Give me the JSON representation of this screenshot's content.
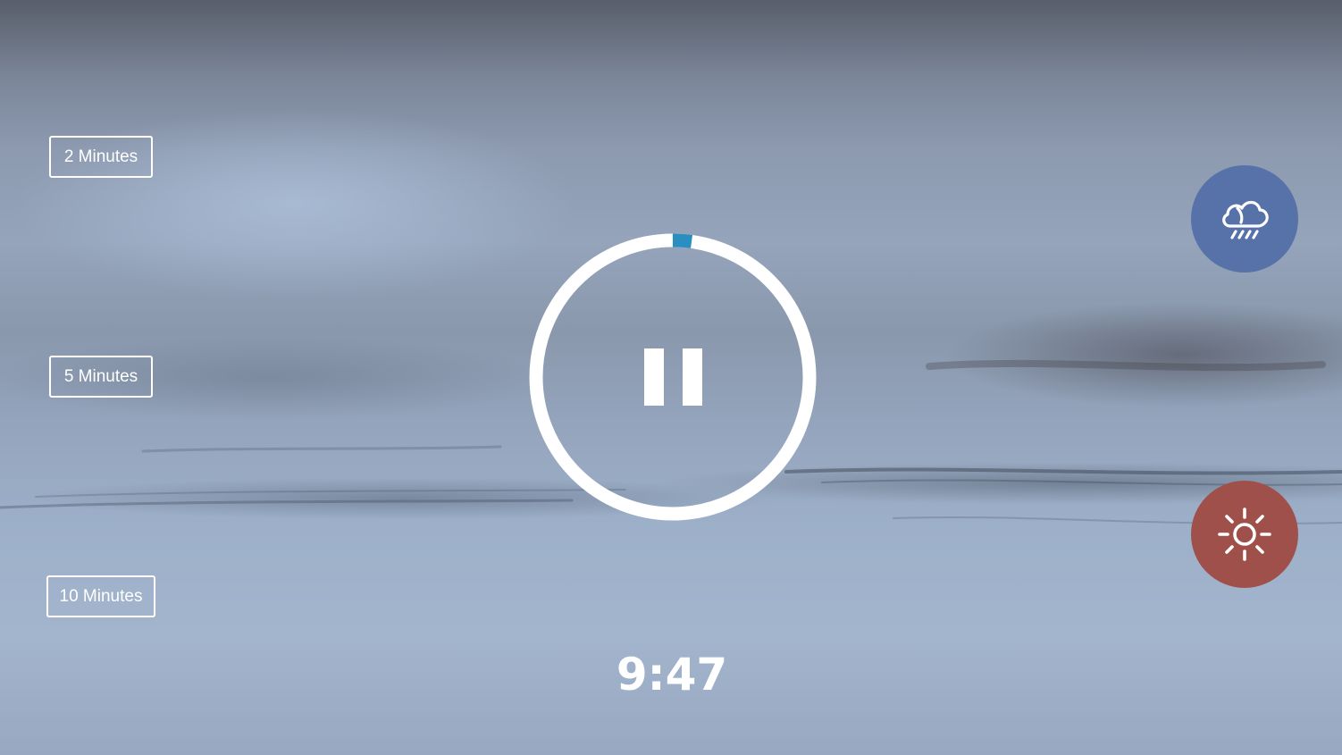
{
  "durations": {
    "two": "2 Minutes",
    "five": "5 Minutes",
    "ten": "10 Minutes"
  },
  "timer": {
    "remaining": "9:47",
    "total_seconds": 600,
    "progress_fraction": 0.022,
    "state_icon": "pause-icon",
    "ring_color": "#ffffff",
    "progress_color": "#2a8ec1"
  },
  "sounds": [
    {
      "icon": "cloud-rain-icon",
      "color": "#5672a8"
    },
    {
      "icon": "sun-icon",
      "color": "#a0504a"
    }
  ]
}
